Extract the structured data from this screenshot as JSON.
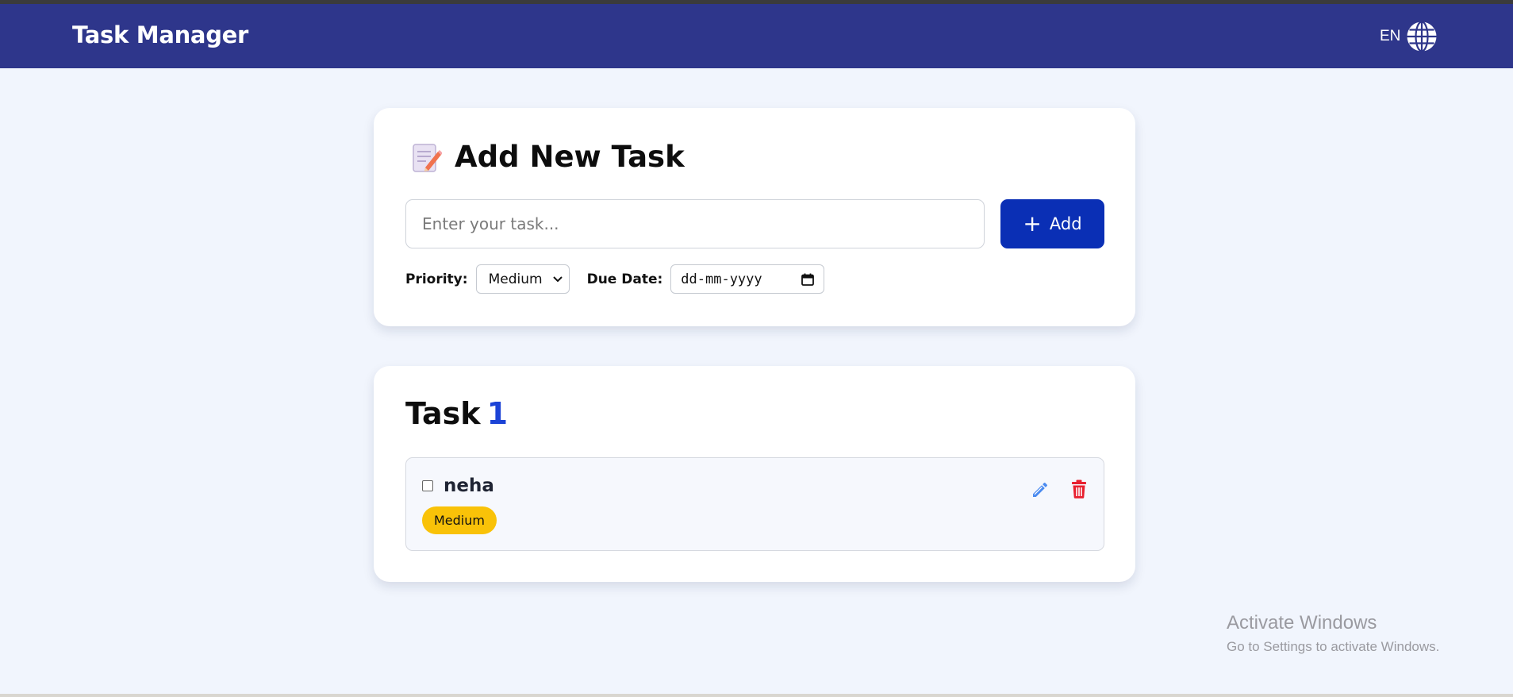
{
  "header": {
    "title": "Task Manager",
    "language": "EN",
    "globe_icon": "globe-icon",
    "background": "#2e368b"
  },
  "add_task": {
    "title": "Add New Task",
    "title_icon": "memo-icon",
    "input_placeholder": "Enter your task...",
    "input_value": "",
    "add_button_label": "Add",
    "add_button_icon": "plus-icon",
    "add_button_color": "#0a2fb5",
    "priority_label": "Priority:",
    "priority_value": "Medium",
    "due_date_label": "Due Date:",
    "due_date_value": "dd-mm-yyyy"
  },
  "task_list": {
    "title": "Task",
    "count": "1",
    "items": [
      {
        "text": "neha",
        "completed": false,
        "priority": "Medium",
        "priority_color": "#f9c208",
        "edit_icon": "pencil-icon",
        "delete_icon": "trash-icon"
      }
    ]
  },
  "watermark": {
    "title": "Activate Windows",
    "subtitle": "Go to Settings to activate Windows."
  }
}
